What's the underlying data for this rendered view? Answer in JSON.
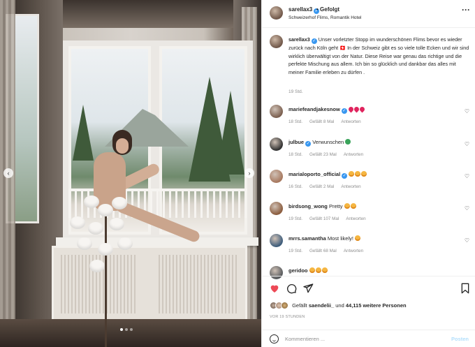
{
  "post": {
    "username": "sarellax3",
    "follow_label": "• Gefolgt",
    "location": "Schweizerhof Flims, Romantik Hotel",
    "caption": "Unser vorletzter Stopp im wunderschönen Flims bevor es wieder zurück nach Köln geht 🇨🇭 In der Schweiz gibt es so viele tolle Ecken und wir sind wirklich überwältigt von der Natur. Diese Reise war genau das richtige und die perfekte Mischung aus allem. Ich bin so glücklich und dankbar das alles mit meiner Familie erleben zu dürfen .",
    "caption_time": "19 Std.",
    "more_icon": "more-options-icon",
    "carousel": {
      "current": 1,
      "total": 3
    }
  },
  "comments": [
    {
      "user": "mariefeandjakesnow",
      "text": "",
      "emoji": [
        "red",
        "red",
        "red"
      ],
      "verified": true,
      "time": "18 Std.",
      "likes": "Gefällt 8 Mal",
      "reply": "Antworten"
    },
    {
      "user": "julbue",
      "text": "Verwunschen",
      "emoji": [
        "green"
      ],
      "verified": true,
      "time": "18 Std.",
      "likes": "Gefällt 23 Mal",
      "reply": "Antworten"
    },
    {
      "user": "marialoporto_official",
      "text": "",
      "emoji": [
        "smile",
        "smile",
        "smile"
      ],
      "verified": true,
      "time": "16 Std.",
      "likes": "Gefällt 2 Mal",
      "reply": "Antworten"
    },
    {
      "user": "birdsong_wong",
      "text": "Pretty",
      "emoji": [
        "smile",
        "smile"
      ],
      "verified": false,
      "time": "19 Std.",
      "likes": "Gefällt 107 Mal",
      "reply": "Antworten"
    },
    {
      "user": "mrrs.samantha",
      "text": "Most likely!",
      "emoji": [
        "smile"
      ],
      "verified": false,
      "time": "19 Std.",
      "likes": "Gefällt 68 Mal",
      "reply": "Antworten"
    },
    {
      "user": "geridoo",
      "text": "",
      "emoji": [
        "smile",
        "smile",
        "smile"
      ],
      "verified": false,
      "time": "",
      "likes": "",
      "reply": ""
    }
  ],
  "likes": {
    "prefix": "Gefällt",
    "first_user": "saendelii_",
    "middle": "und",
    "count": "44,115 weitere Personen"
  },
  "posted_ago": "VOR 19 STUNDEN",
  "comment_input": {
    "placeholder": "Kommentieren ...",
    "post_label": "Posten"
  },
  "icons": [
    "like-icon",
    "comment-icon",
    "share-icon",
    "save-icon",
    "emoji-icon",
    "heart-icon",
    "chevron-left-icon",
    "chevron-right-icon"
  ],
  "colors": {
    "like_red": "#ed4956",
    "verified_blue": "#3897f0",
    "post_disabled": "#b2dffc",
    "muted": "#8e8e8e"
  }
}
